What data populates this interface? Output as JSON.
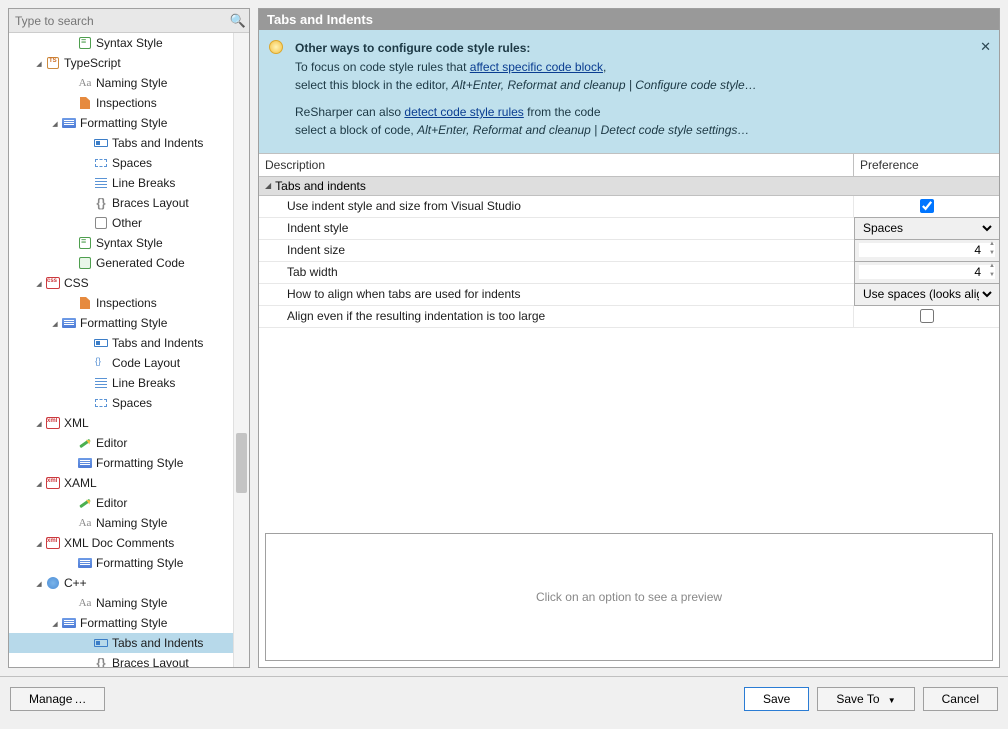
{
  "search": {
    "placeholder": "Type to search"
  },
  "tree": [
    {
      "depth": 3,
      "icon": "syntax",
      "label": "Syntax Style"
    },
    {
      "depth": 1,
      "arrow": "open",
      "icon": "ts",
      "label": "TypeScript"
    },
    {
      "depth": 3,
      "icon": "aa",
      "label": "Naming Style"
    },
    {
      "depth": 3,
      "icon": "insp",
      "label": "Inspections"
    },
    {
      "depth": 2,
      "arrow": "open",
      "icon": "format",
      "label": "Formatting Style"
    },
    {
      "depth": 4,
      "icon": "tab",
      "label": "Tabs and Indents"
    },
    {
      "depth": 4,
      "icon": "spaces",
      "label": "Spaces"
    },
    {
      "depth": 4,
      "icon": "lines",
      "label": "Line Breaks"
    },
    {
      "depth": 4,
      "icon": "braces",
      "label": "Braces Layout"
    },
    {
      "depth": 4,
      "icon": "other",
      "label": "Other"
    },
    {
      "depth": 3,
      "icon": "syntax",
      "label": "Syntax Style"
    },
    {
      "depth": 3,
      "icon": "gen",
      "label": "Generated Code"
    },
    {
      "depth": 1,
      "arrow": "open",
      "icon": "css",
      "label": "CSS"
    },
    {
      "depth": 3,
      "icon": "insp",
      "label": "Inspections"
    },
    {
      "depth": 2,
      "arrow": "open",
      "icon": "format",
      "label": "Formatting Style"
    },
    {
      "depth": 4,
      "icon": "tab",
      "label": "Tabs and Indents"
    },
    {
      "depth": 4,
      "icon": "code",
      "label": "Code Layout"
    },
    {
      "depth": 4,
      "icon": "lines",
      "label": "Line Breaks"
    },
    {
      "depth": 4,
      "icon": "spaces",
      "label": "Spaces"
    },
    {
      "depth": 1,
      "arrow": "open",
      "icon": "xml",
      "label": "XML"
    },
    {
      "depth": 3,
      "icon": "pencil",
      "label": "Editor"
    },
    {
      "depth": 3,
      "icon": "format",
      "label": "Formatting Style"
    },
    {
      "depth": 1,
      "arrow": "open",
      "icon": "xml",
      "label": "XAML"
    },
    {
      "depth": 3,
      "icon": "pencil",
      "label": "Editor"
    },
    {
      "depth": 3,
      "icon": "aa",
      "label": "Naming Style"
    },
    {
      "depth": 1,
      "arrow": "open",
      "icon": "xml",
      "label": "XML Doc Comments"
    },
    {
      "depth": 3,
      "icon": "format",
      "label": "Formatting Style"
    },
    {
      "depth": 1,
      "arrow": "open",
      "icon": "cpp",
      "label": "C++"
    },
    {
      "depth": 3,
      "icon": "aa",
      "label": "Naming Style"
    },
    {
      "depth": 2,
      "arrow": "open",
      "icon": "format",
      "label": "Formatting Style"
    },
    {
      "depth": 4,
      "icon": "tab",
      "label": "Tabs and Indents",
      "selected": true
    },
    {
      "depth": 4,
      "icon": "braces",
      "label": "Braces Layout"
    }
  ],
  "panel": {
    "title": "Tabs and Indents",
    "info": {
      "title": "Other ways to configure code style rules:",
      "l1a": "To focus on code style rules that ",
      "l1link": "affect specific code block",
      "l1b": ",",
      "l2a": "select this block in the editor, ",
      "l2cmd": "Alt+Enter, Reformat and cleanup | Configure code style…",
      "l3a": "ReSharper can also ",
      "l3link": "detect code style rules",
      "l3b": " from the code",
      "l4a": "select a block of code, ",
      "l4cmd": "Alt+Enter, Reformat and cleanup | Detect code style settings…"
    },
    "columns": {
      "desc": "Description",
      "pref": "Preference"
    },
    "section": "Tabs and indents",
    "rows": [
      {
        "desc": "Use indent style and size from Visual Studio",
        "type": "check",
        "value": true
      },
      {
        "desc": "Indent style",
        "type": "select",
        "value": "Spaces"
      },
      {
        "desc": "Indent size",
        "type": "num",
        "value": "4"
      },
      {
        "desc": "Tab width",
        "type": "num",
        "value": "4"
      },
      {
        "desc": "How to align when tabs are used for indents",
        "type": "select",
        "value": "Use spaces (looks aligned"
      },
      {
        "desc": "Align even if the resulting indentation is too large",
        "type": "check",
        "value": false
      }
    ],
    "preview": "Click on an option to see a preview"
  },
  "buttons": {
    "manage": "Manage",
    "save": "Save",
    "saveTo": "Save To",
    "cancel": "Cancel"
  }
}
